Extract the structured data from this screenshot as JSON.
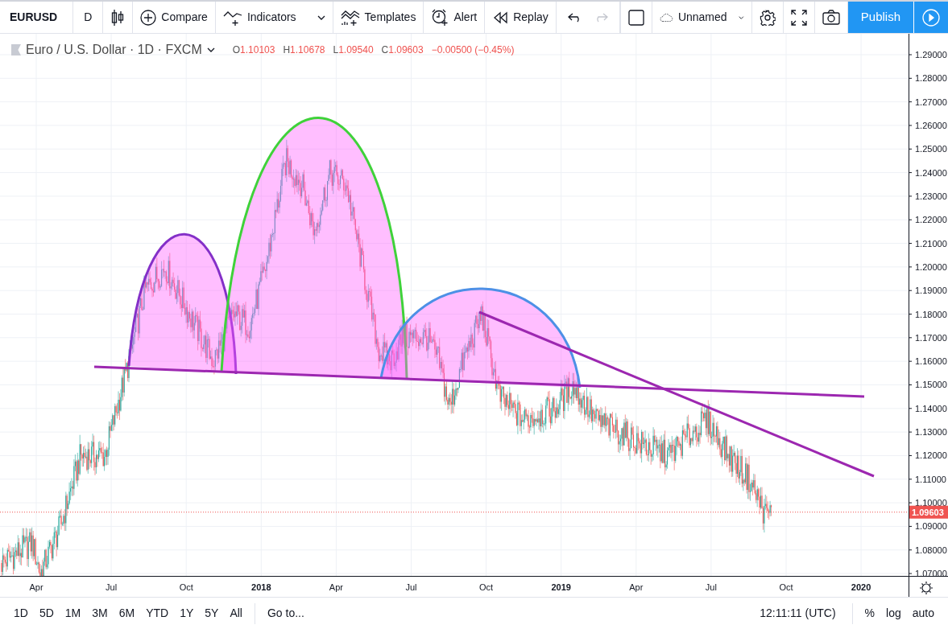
{
  "toolbar": {
    "symbol": "EURUSD",
    "interval": "D",
    "buttons": [
      {
        "kind": "compare",
        "label": "Compare",
        "caret": false
      },
      {
        "kind": "indicators",
        "label": "Indicators",
        "caret": true
      },
      {
        "kind": "templates",
        "label": "Templates",
        "caret": false
      },
      {
        "kind": "alert",
        "label": "Alert",
        "caret": false
      },
      {
        "kind": "replay",
        "label": "Replay",
        "caret": false
      }
    ],
    "undo": {
      "disabled": false
    },
    "redo": {
      "disabled": true
    },
    "layout_name": "Unnamed",
    "publish": "Publish"
  },
  "legend": {
    "title": "Euro / U.S. Dollar · 1D · FXCM",
    "ohlc": [
      {
        "label": "O",
        "value": "1.10103"
      },
      {
        "label": "H",
        "value": "1.10678"
      },
      {
        "label": "L",
        "value": "1.09540"
      },
      {
        "label": "C",
        "value": "1.09603"
      }
    ],
    "change": "−0.00500 (−0.45%)"
  },
  "price_axis": {
    "labels": [
      "1.29000",
      "1.28000",
      "1.27000",
      "1.26000",
      "1.25000",
      "1.24000",
      "1.23000",
      "1.22000",
      "1.21000",
      "1.20000",
      "1.19000",
      "1.18000",
      "1.17000",
      "1.16000",
      "1.15000",
      "1.14000",
      "1.13000",
      "1.12000",
      "1.11000",
      "1.10000",
      "1.09000",
      "1.08000",
      "1.07000"
    ],
    "last_price": "1.09603"
  },
  "time_axis": {
    "labels": [
      {
        "text": "Apr",
        "kind": "month"
      },
      {
        "text": "Jul",
        "kind": "month"
      },
      {
        "text": "Oct",
        "kind": "month"
      },
      {
        "text": "2018",
        "kind": "year"
      },
      {
        "text": "Apr",
        "kind": "month"
      },
      {
        "text": "Jul",
        "kind": "month"
      },
      {
        "text": "Oct",
        "kind": "month"
      },
      {
        "text": "2019",
        "kind": "year"
      },
      {
        "text": "Apr",
        "kind": "month"
      },
      {
        "text": "Jul",
        "kind": "month"
      },
      {
        "text": "Oct",
        "kind": "month"
      },
      {
        "text": "2020",
        "kind": "year"
      }
    ]
  },
  "bottom_bar": {
    "ranges": [
      "1D",
      "5D",
      "1M",
      "3M",
      "6M",
      "YTD",
      "1Y",
      "5Y",
      "All"
    ],
    "goto": "Go to...",
    "clock": "12:11:11 (UTC)",
    "options": [
      "%",
      "log",
      "auto"
    ]
  }
}
